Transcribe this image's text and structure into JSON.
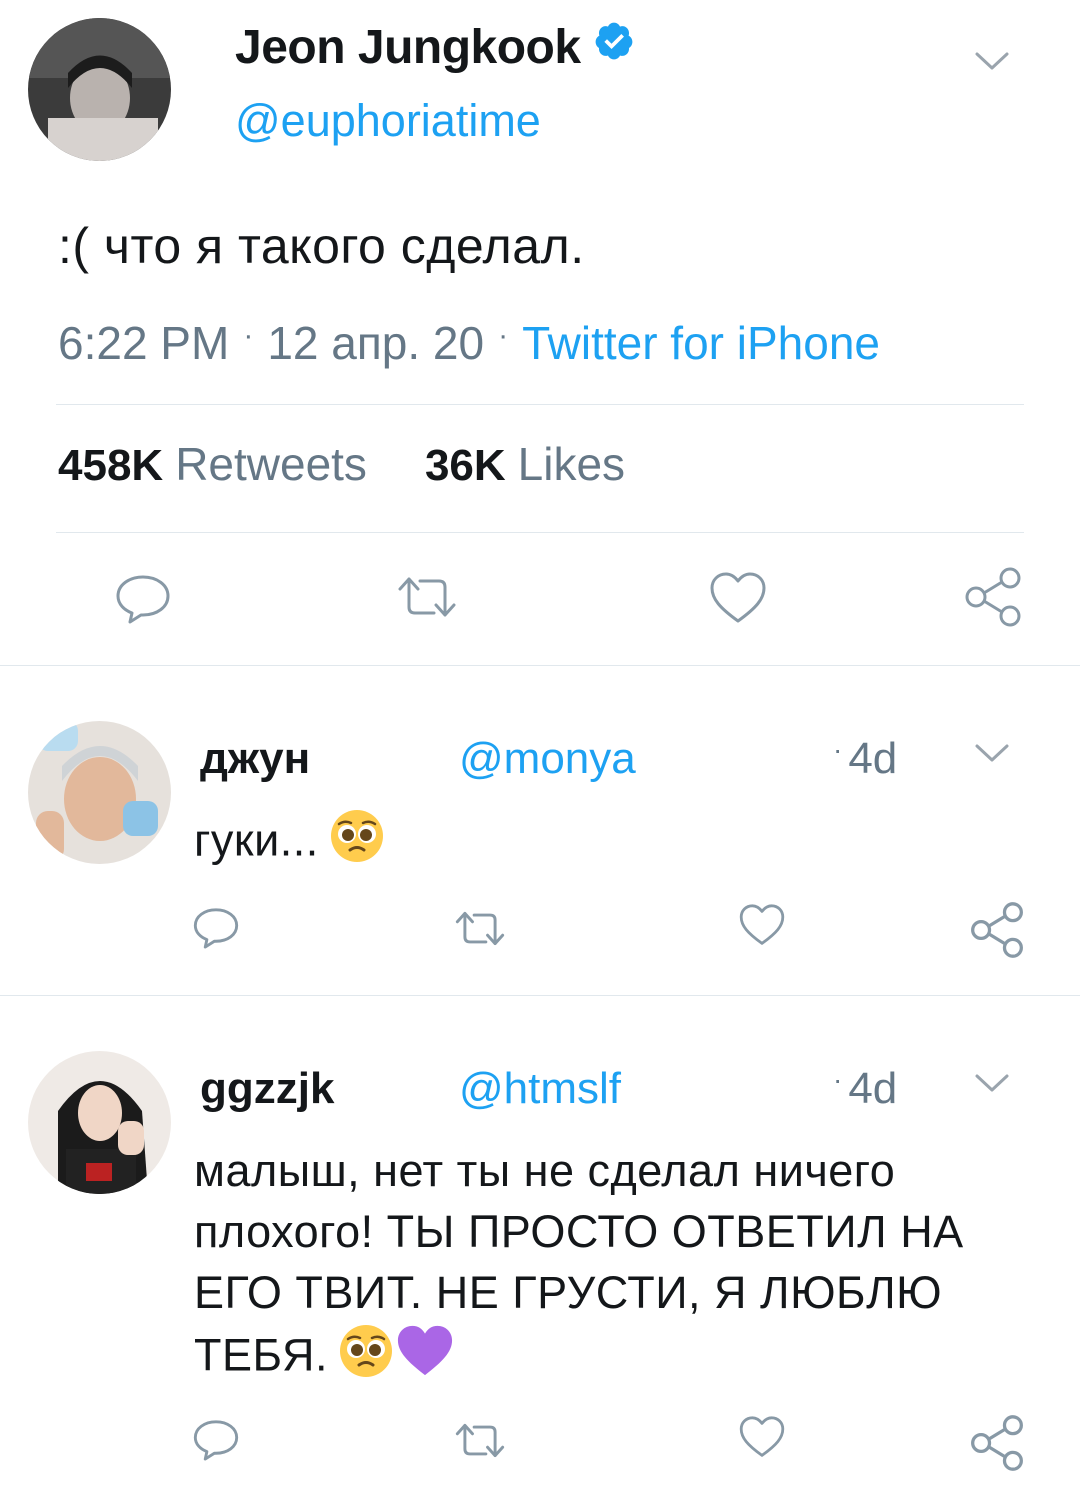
{
  "main_tweet": {
    "display_name": "Jeon Jungkook",
    "handle": "@euphoriatime",
    "verified_icon": "verified-badge-icon",
    "text": ":( что я такого сделал.",
    "time": "6:22 PM",
    "date": "12 апр. 20",
    "source": "Twitter for iPhone",
    "retweets_count": "458K",
    "retweets_label": "Retweets",
    "likes_count": "36K",
    "likes_label": "Likes"
  },
  "replies": [
    {
      "display_name": "джун",
      "handle": "@monya",
      "time": "4d",
      "text": "гуки..."
    },
    {
      "display_name": "ggzzjk",
      "handle": "@htmslf",
      "time": "4d",
      "text": "малыш, нет ты не сделал ничего плохого! ТЫ ПРОСТО ОТВЕТИЛ НА ЕГО ТВИТ. НЕ ГРУСТИ, Я ЛЮБЛЮ ТЕБЯ."
    }
  ],
  "colors": {
    "accent": "#1da1f2",
    "secondary_text": "#657786",
    "divider": "#e1e8ed"
  },
  "icons": [
    "reply-icon",
    "retweet-icon",
    "like-icon",
    "share-icon",
    "chevron-down-icon",
    "pleading-face-emoji",
    "purple-heart-emoji"
  ]
}
